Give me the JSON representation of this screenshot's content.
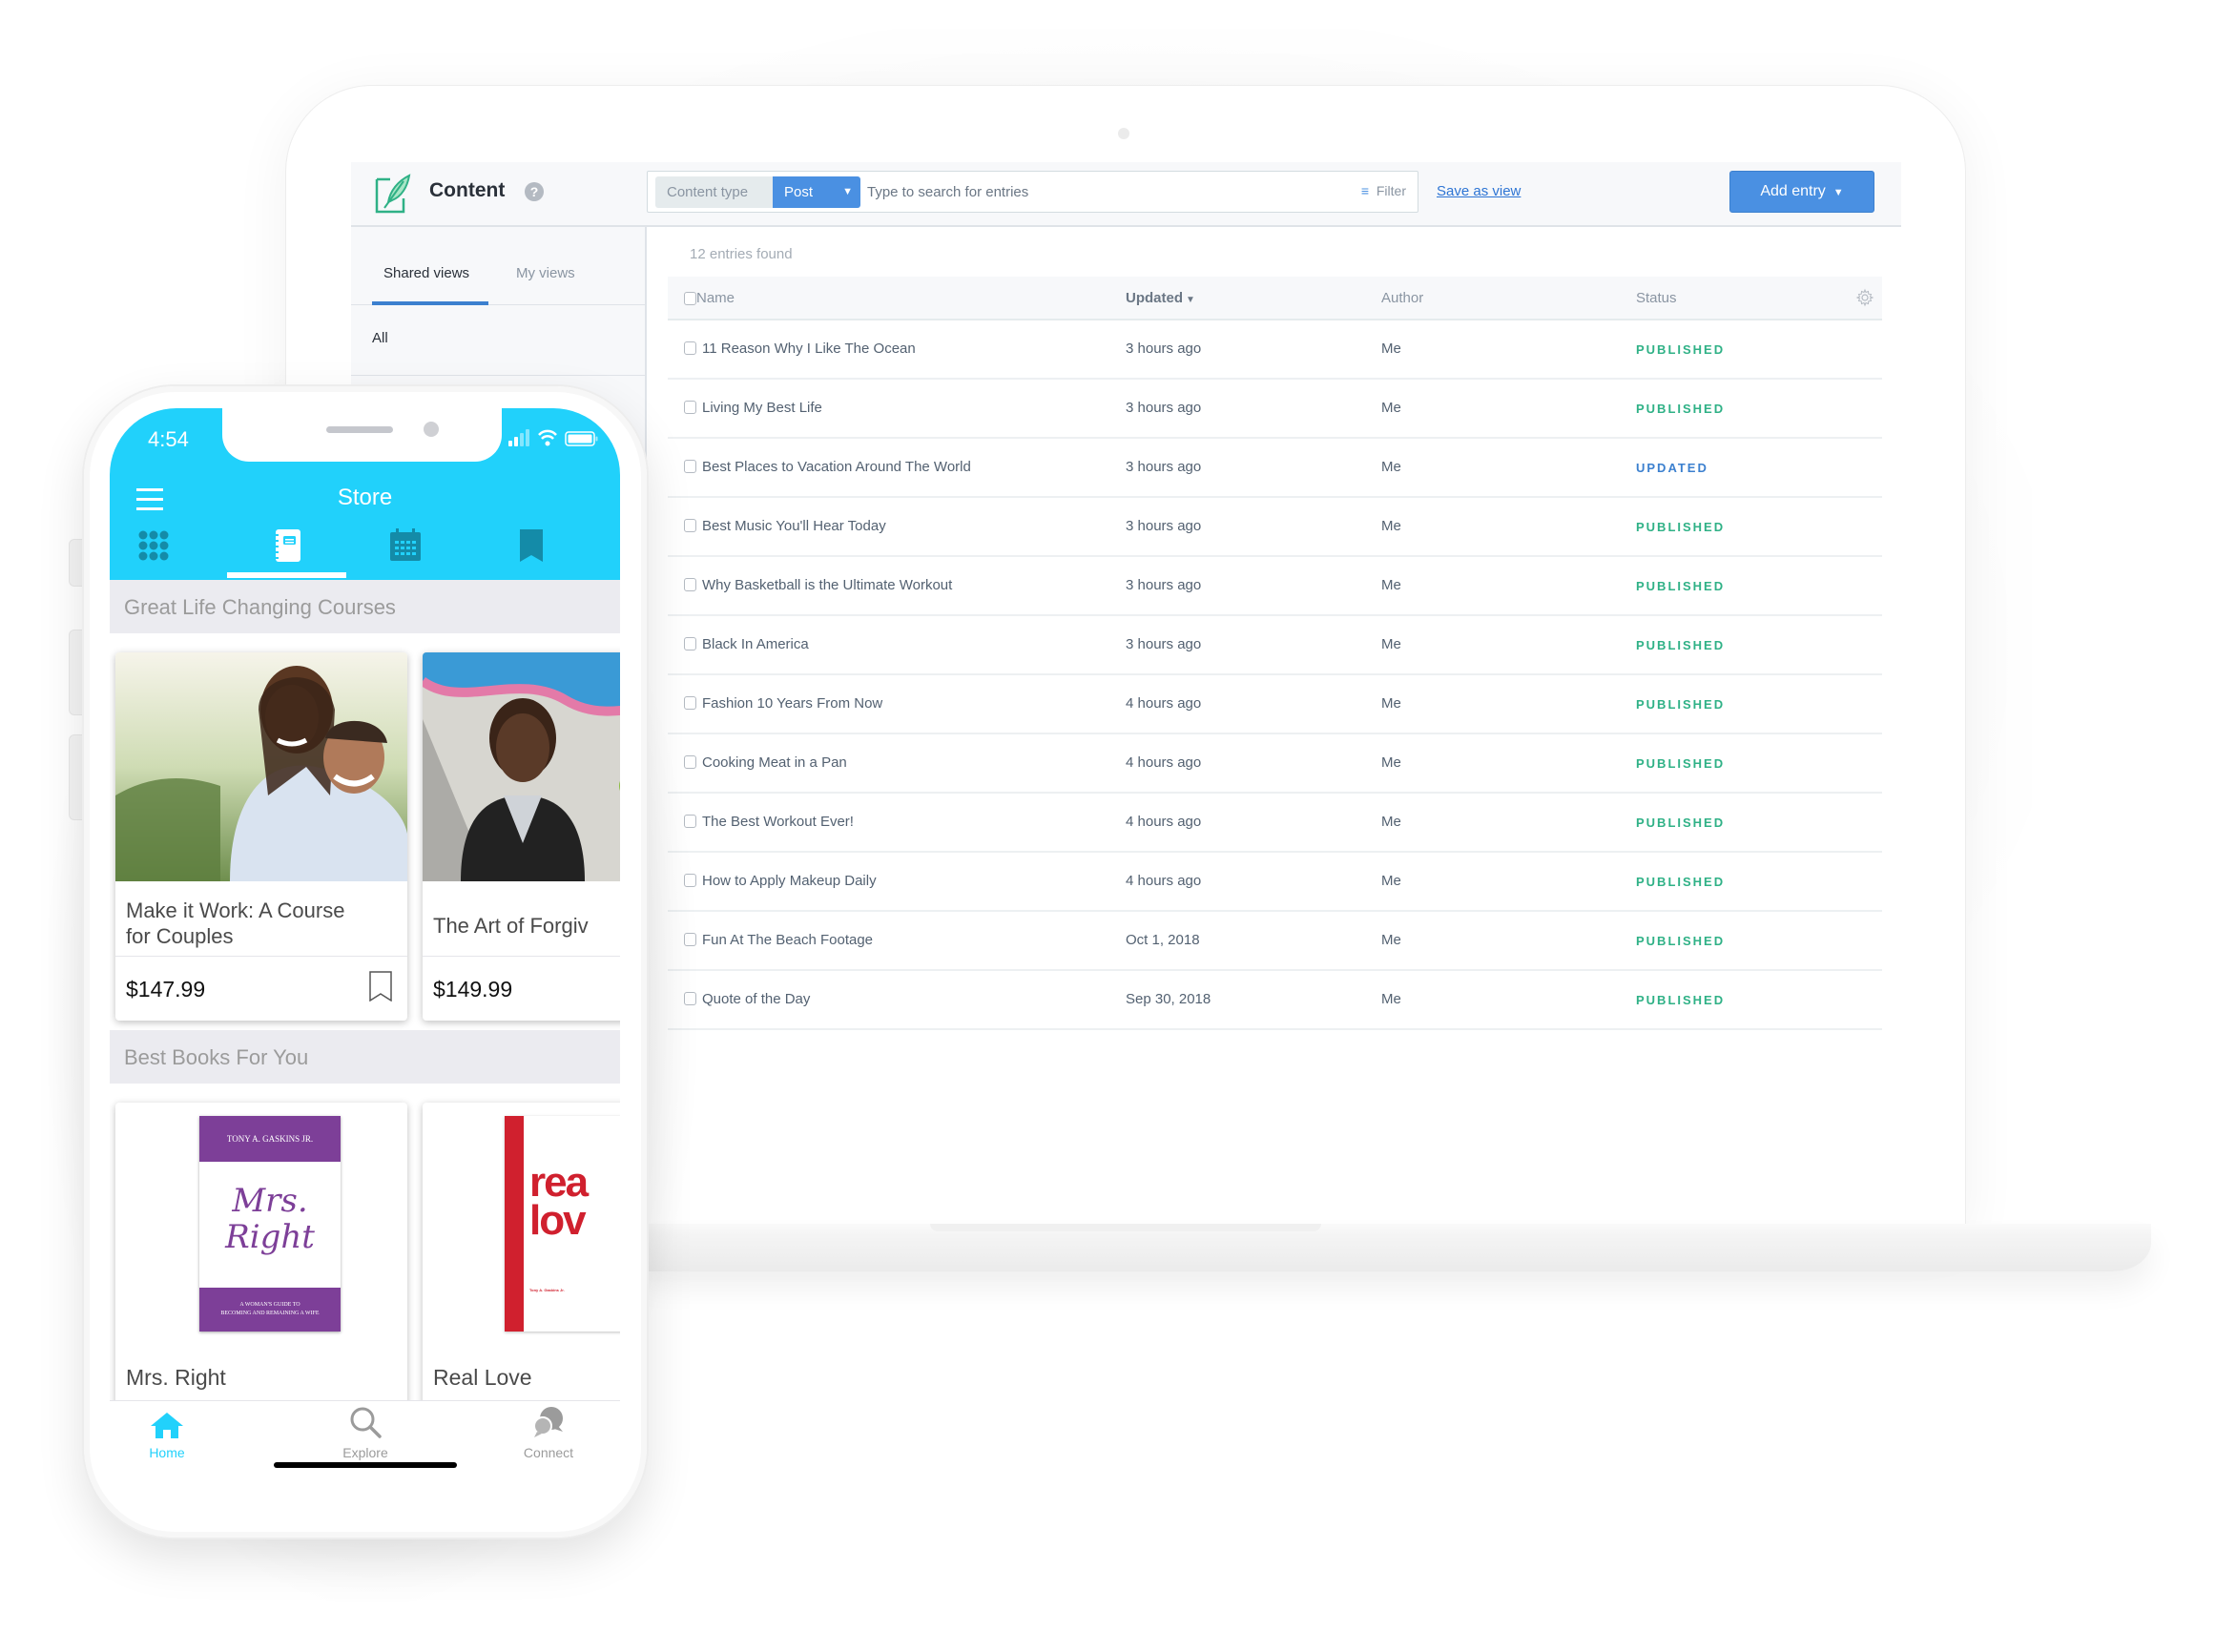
{
  "cms": {
    "header": {
      "title": "Content",
      "help_icon": "?",
      "content_type_label": "Content type",
      "content_type_value": "Post",
      "search_placeholder": "Type to search for entries",
      "filter_label": "Filter",
      "save_view_label": "Save as view",
      "add_entry_label": "Add entry"
    },
    "sidebar": {
      "tabs": [
        {
          "label": "Shared views",
          "active": true
        },
        {
          "label": "My views",
          "active": false
        }
      ],
      "items": [
        {
          "label": "All"
        }
      ]
    },
    "entries_found": "12 entries found",
    "table": {
      "columns": [
        "Name",
        "Updated",
        "Author",
        "Status"
      ],
      "sorted_column": "Updated",
      "rows": [
        {
          "name": "11 Reason Why I Like The Ocean",
          "updated": "3 hours ago",
          "author": "Me",
          "status": "PUBLISHED"
        },
        {
          "name": "Living My Best Life",
          "updated": "3 hours ago",
          "author": "Me",
          "status": "PUBLISHED"
        },
        {
          "name": "Best Places to Vacation Around The World",
          "updated": "3 hours ago",
          "author": "Me",
          "status": "UPDATED"
        },
        {
          "name": "Best Music You'll Hear Today",
          "updated": "3 hours ago",
          "author": "Me",
          "status": "PUBLISHED"
        },
        {
          "name": "Why Basketball is the Ultimate Workout",
          "updated": "3 hours ago",
          "author": "Me",
          "status": "PUBLISHED"
        },
        {
          "name": "Black In America",
          "updated": "3 hours ago",
          "author": "Me",
          "status": "PUBLISHED"
        },
        {
          "name": "Fashion 10 Years From Now",
          "updated": "4 hours ago",
          "author": "Me",
          "status": "PUBLISHED"
        },
        {
          "name": "Cooking Meat in a Pan",
          "updated": "4 hours ago",
          "author": "Me",
          "status": "PUBLISHED"
        },
        {
          "name": "The Best Workout Ever!",
          "updated": "4 hours ago",
          "author": "Me",
          "status": "PUBLISHED"
        },
        {
          "name": "How to Apply Makeup Daily",
          "updated": "4 hours ago",
          "author": "Me",
          "status": "PUBLISHED"
        },
        {
          "name": "Fun At The Beach Footage",
          "updated": "Oct 1, 2018",
          "author": "Me",
          "status": "PUBLISHED"
        },
        {
          "name": "Quote of the Day",
          "updated": "Sep 30, 2018",
          "author": "Me",
          "status": "PUBLISHED"
        }
      ]
    },
    "colors": {
      "published": "#2fb186",
      "updated": "#3c80cf",
      "primary": "#4a90e2",
      "logo_green": "#2fb186"
    }
  },
  "phone": {
    "time": "4:54",
    "title": "Store",
    "top_tabs": [
      "grid-icon",
      "notebook-icon",
      "calendar-icon",
      "bookmark-icon"
    ],
    "active_top_tab": 1,
    "sections": [
      {
        "title": "Great Life Changing Courses",
        "cards": [
          {
            "title_line1": "Make it Work: A Course",
            "title_line2": "for Couples",
            "price": "$147.99"
          },
          {
            "title_line1": "The Art of Forgiv",
            "title_line2": "",
            "price": "$149.99"
          }
        ]
      },
      {
        "title": "Best Books For You",
        "cards": [
          {
            "title": "Mrs. Right",
            "cover_author": "TONY A. GASKINS JR.",
            "cover_title": "Mrs. Right",
            "cover_subtitle_1": "A WOMAN'S GUIDE TO",
            "cover_subtitle_2": "BECOMING AND REMAINING A WIFE"
          },
          {
            "title": "Real Love",
            "cover_title_1": "rea",
            "cover_title_2": "lov",
            "cover_author": "Tony A. Gaskins Jr."
          }
        ]
      }
    ],
    "tabbar": [
      {
        "label": "Home",
        "icon": "home-icon",
        "active": true
      },
      {
        "label": "Explore",
        "icon": "search-icon",
        "active": false
      },
      {
        "label": "Connect",
        "icon": "chat-icon",
        "active": false
      }
    ],
    "colors": {
      "accent": "#21d1fb",
      "tab_icon_inactive": "#148ba8",
      "section_bg": "#ebebf0",
      "book_purple": "#7d3f98",
      "book_red": "#d0202e"
    }
  }
}
